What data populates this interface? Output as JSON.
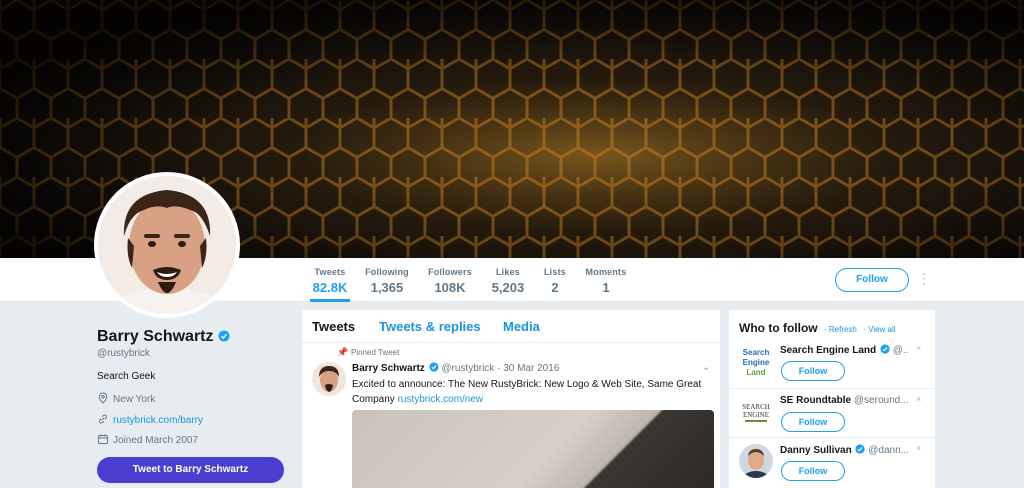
{
  "profile": {
    "name": "Barry Schwartz",
    "handle": "@rustybrick",
    "bio": "Search Geek",
    "location": "New York",
    "website": "rustybrick.com/barry",
    "joined": "Joined March 2007",
    "tweet_to_label": "Tweet to Barry Schwartz"
  },
  "stats": [
    {
      "label": "Tweets",
      "value": "82.8K"
    },
    {
      "label": "Following",
      "value": "1,365"
    },
    {
      "label": "Followers",
      "value": "108K"
    },
    {
      "label": "Likes",
      "value": "5,203"
    },
    {
      "label": "Lists",
      "value": "2"
    },
    {
      "label": "Moments",
      "value": "1"
    }
  ],
  "follow_label": "Follow",
  "timeline": {
    "tabs": [
      "Tweets",
      "Tweets & replies",
      "Media"
    ],
    "pinned_label": "Pinned Tweet",
    "tweet": {
      "name": "Barry Schwartz",
      "handle": "@rustybrick",
      "date": "· 30 Mar 2016",
      "text": "Excited to announce: The New RustyBrick: New Logo & Web Site, Same Great Company ",
      "link": "rustybrick.com/new"
    }
  },
  "who_to_follow": {
    "title": "Who to follow",
    "refresh": "· Refresh",
    "view_all": "· View all",
    "items": [
      {
        "name": "Search Engine Land",
        "handle": "@...",
        "follow": "Follow"
      },
      {
        "name": "SE Roundtable",
        "handle": "@seround...",
        "follow": "Follow"
      },
      {
        "name": "Danny Sullivan",
        "handle": "@dann...",
        "follow": "Follow"
      }
    ]
  },
  "colors": {
    "accent": "#1da1f2",
    "button": "#4a3ed1"
  }
}
